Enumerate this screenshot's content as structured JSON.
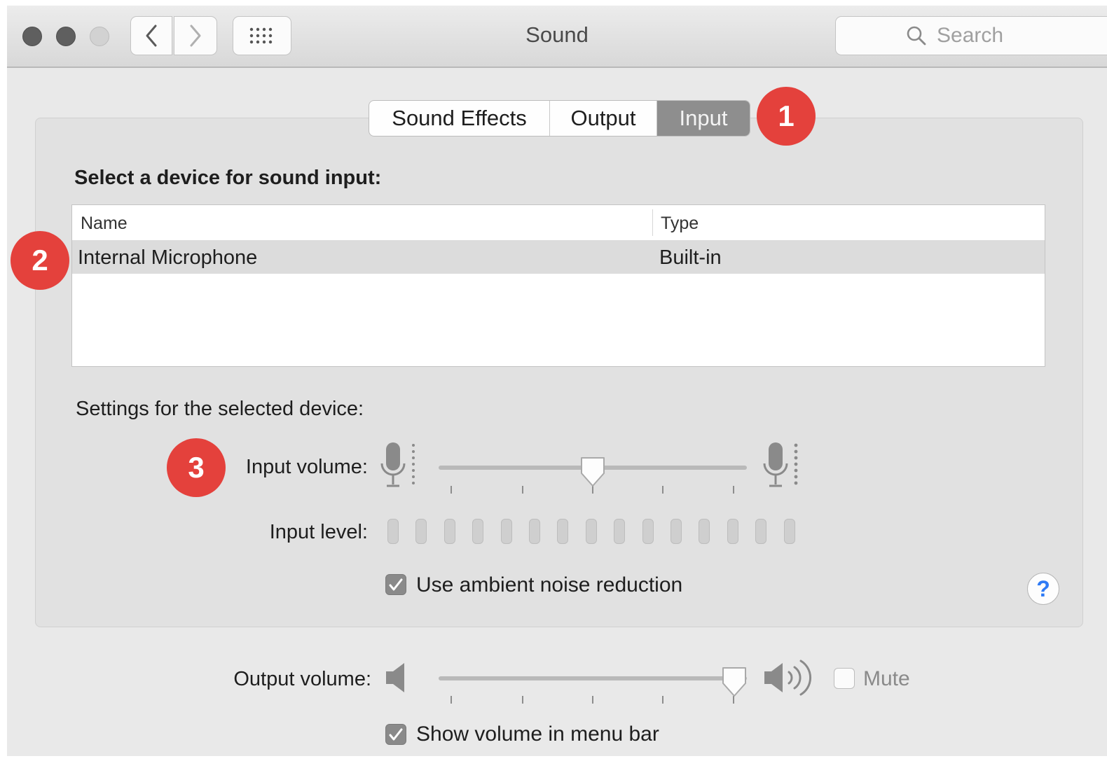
{
  "window": {
    "title": "Sound"
  },
  "search": {
    "placeholder": "Search"
  },
  "tabs": [
    {
      "label": "Sound Effects",
      "selected": false
    },
    {
      "label": "Output",
      "selected": false
    },
    {
      "label": "Input",
      "selected": true
    }
  ],
  "callouts": [
    "1",
    "2",
    "3"
  ],
  "input": {
    "select_label": "Select a device for sound input:",
    "table": {
      "columns": [
        "Name",
        "Type"
      ],
      "rows": [
        {
          "name": "Internal Microphone",
          "type": "Built-in",
          "selected": true
        }
      ]
    },
    "settings_label": "Settings for the selected device:",
    "volume_label": "Input volume:",
    "volume_level": 0.5,
    "level_label": "Input level:",
    "level_segments": 15,
    "level_active": 0,
    "noise_reduction": {
      "label": "Use ambient noise reduction",
      "checked": true
    },
    "help_label": "?"
  },
  "output": {
    "volume_label": "Output volume:",
    "volume_level": 0.96,
    "mute": {
      "label": "Mute",
      "checked": false
    },
    "menu_bar": {
      "label": "Show volume in menu bar",
      "checked": true
    }
  },
  "colors": {
    "accent_badge": "#e4413c",
    "selected_tab": "#8e8e8e",
    "help_icon": "#2f7bf5"
  }
}
